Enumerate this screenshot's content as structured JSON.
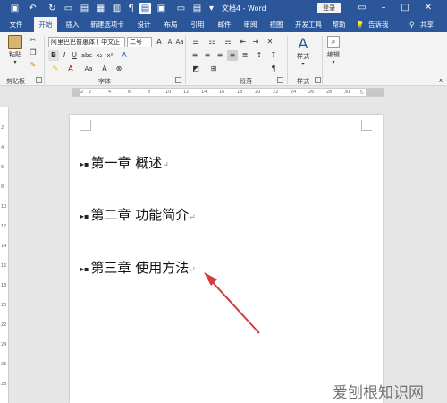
{
  "titlebar": {
    "doc_title": "文档4 - Word",
    "login": "登录",
    "bg_color": "#2b579a"
  },
  "tabs": [
    "文件",
    "开始",
    "插入",
    "新建选项卡",
    "设计",
    "布局",
    "引用",
    "邮件",
    "审阅",
    "视图",
    "开发工具",
    "帮助"
  ],
  "active_tab": "开始",
  "tell_me": "告诉我",
  "share": "共享",
  "ribbon": {
    "paste": "粘贴",
    "font_name": "阿里巴巴普惠体 ( 中文正",
    "font_size": "二号",
    "styles": "样式",
    "editing": "编辑",
    "groups": [
      "剪贴板",
      "字体",
      "段落",
      "样式"
    ]
  },
  "document": {
    "headings": [
      "第一章 概述",
      "第二章 功能简介",
      "第三章 使用方法"
    ]
  },
  "arrow_color": "#d43c3c",
  "watermark": "爱刨根知识网"
}
